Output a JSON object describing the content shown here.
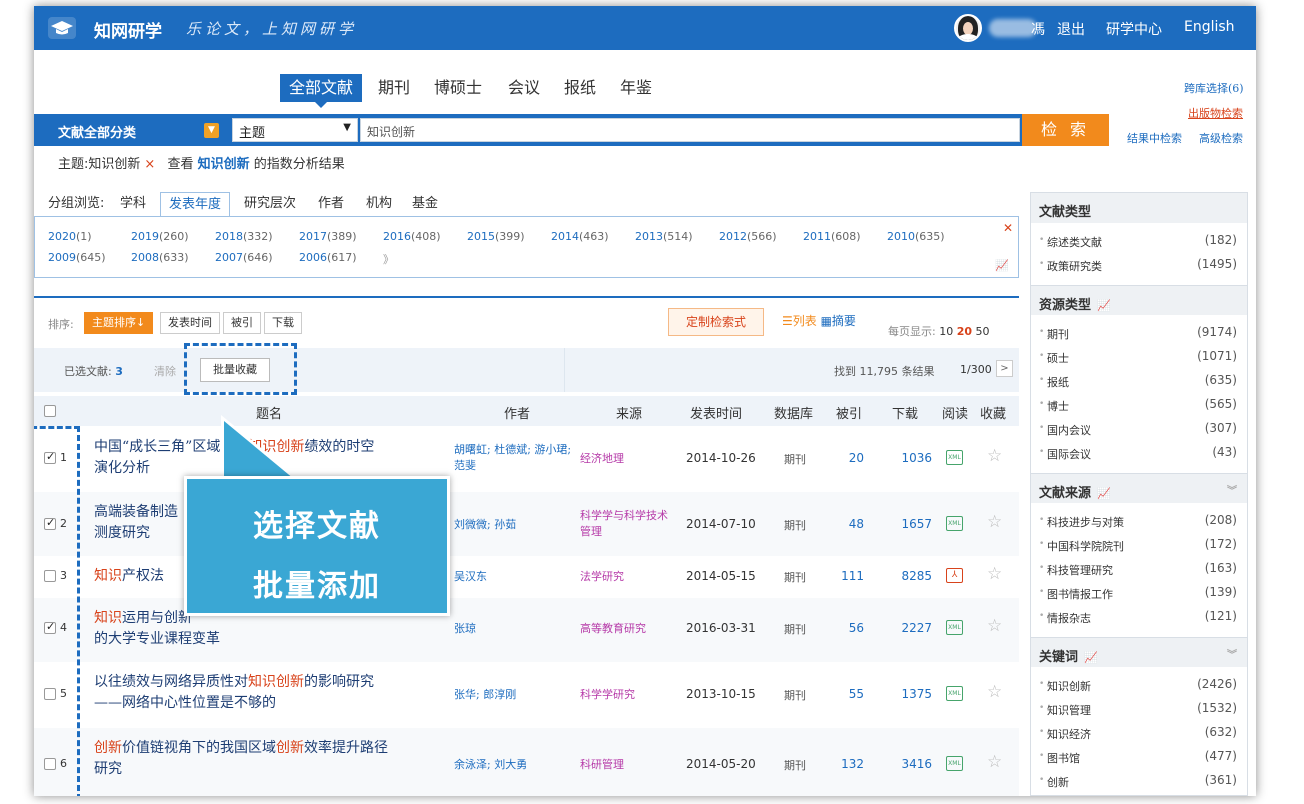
{
  "header": {
    "logo_text": "知网研学",
    "slogan": "乐论文，上知网研学",
    "user_suffix": "馮",
    "links": [
      "退出",
      "研学中心",
      "English"
    ]
  },
  "db_tabs": [
    "全部文献",
    "期刊",
    "博硕士",
    "会议",
    "报纸",
    "年鉴"
  ],
  "search": {
    "category": "文献全部分类",
    "field": "主题",
    "query": "知识创新",
    "button": "检 索"
  },
  "side_links": [
    "跨库选择(6)",
    "出版物检索",
    "结果中检索",
    "高级检索"
  ],
  "crumb": {
    "filter": "主题:知识创新",
    "close": "×",
    "prefix": "查看",
    "keyword": "知识创新",
    "suffix": "的指数分析结果"
  },
  "group_browse": {
    "label": "分组浏览:",
    "items": [
      "学科",
      "发表年度",
      "研究层次",
      "作者",
      "机构",
      "基金"
    ],
    "active": "发表年度"
  },
  "years_row1": [
    {
      "year": "2020",
      "count": "(1)"
    },
    {
      "year": "2019",
      "count": "(260)"
    },
    {
      "year": "2018",
      "count": "(332)"
    },
    {
      "year": "2017",
      "count": "(389)"
    },
    {
      "year": "2016",
      "count": "(408)"
    },
    {
      "year": "2015",
      "count": "(399)"
    },
    {
      "year": "2014",
      "count": "(463)"
    },
    {
      "year": "2013",
      "count": "(514)"
    },
    {
      "year": "2012",
      "count": "(566)"
    },
    {
      "year": "2011",
      "count": "(608)"
    },
    {
      "year": "2010",
      "count": "(635)"
    }
  ],
  "years_row2": [
    {
      "year": "2009",
      "count": "(645)"
    },
    {
      "year": "2008",
      "count": "(633)"
    },
    {
      "year": "2007",
      "count": "(646)"
    },
    {
      "year": "2006",
      "count": "(617)"
    },
    {
      "year": "》",
      "count": ""
    }
  ],
  "toolbar": {
    "sort_label": "排序:",
    "sort_buttons": [
      "主题排序↓",
      "发表时间",
      "被引",
      "下载"
    ],
    "custom": "定制检索式",
    "view_list": "☰列表",
    "view_abstract": "▦摘要",
    "per_page_label": "每页显示:",
    "per_page": [
      "10",
      "20",
      "50"
    ]
  },
  "selection": {
    "label": "已选文献:",
    "count": "3",
    "clear": "清除",
    "batch": "批量收藏",
    "found": "找到 11,795 条结果",
    "pager": "1/300"
  },
  "columns": [
    "题名",
    "作者",
    "来源",
    "发表时间",
    "数据库",
    "被引",
    "下载",
    "阅读",
    "收藏"
  ],
  "rows": [
    {
      "num": "1",
      "checked": true,
      "t1a": "中国“成长三角”区域高校",
      "t1h": "知识创新",
      "t1b": "绩效的时空",
      "t2": "演化分析",
      "author": "胡曙虹; 杜德斌; 游小珺; 范斐",
      "source": "经济地理",
      "date": "2014-10-26",
      "db": "期刊",
      "cite": "20",
      "dl": "1036",
      "fmt": "XML"
    },
    {
      "num": "2",
      "checked": true,
      "t1a": "高端装备制造",
      "t1h": "",
      "t1b": "",
      "t2": "测度研究",
      "author": "刘微微; 孙茹",
      "source": "科学学与科学技术管理",
      "date": "2014-07-10",
      "db": "期刊",
      "cite": "48",
      "dl": "1657",
      "fmt": "XML"
    },
    {
      "num": "3",
      "checked": false,
      "t1a": "",
      "t1h": "知识",
      "t1b": "产权法",
      "t2": "",
      "author": "吴汉东",
      "source": "法学研究",
      "date": "2014-05-15",
      "db": "期刊",
      "cite": "111",
      "dl": "8285",
      "fmt": "PDF"
    },
    {
      "num": "4",
      "checked": true,
      "t1a": "",
      "t1h": "知识",
      "t1b": "运用与创新",
      "t2": "的大学专业课程变革",
      "author": "张琼",
      "source": "高等教育研究",
      "date": "2016-03-31",
      "db": "期刊",
      "cite": "56",
      "dl": "2227",
      "fmt": "XML"
    },
    {
      "num": "5",
      "checked": false,
      "t1a": "以往绩效与网络异质性对",
      "t1h": "知识创新",
      "t1b": "的影响研究",
      "t2": "——网络中心性位置是不够的",
      "author": "张华; 郎淳刚",
      "source": "科学学研究",
      "date": "2013-10-15",
      "db": "期刊",
      "cite": "55",
      "dl": "1375",
      "fmt": "XML"
    },
    {
      "num": "6",
      "checked": false,
      "t1a": "",
      "t1h": "创新",
      "t1b": "价值链视角下的我国区域",
      "t1h2": "创新",
      "t1c": "效率提升路径",
      "t2": "研究",
      "author": "余泳泽; 刘大勇",
      "source": "科研管理",
      "date": "2014-05-20",
      "db": "期刊",
      "cite": "132",
      "dl": "3416",
      "fmt": "XML"
    }
  ],
  "callout": {
    "line1": "选择文献",
    "line2": "批量添加"
  },
  "sidebar": {
    "sections": [
      {
        "title": "文献类型",
        "chart": false,
        "items": [
          {
            "label": "综述类文献",
            "count": "(182)"
          },
          {
            "label": "政策研究类",
            "count": "(1495)"
          }
        ]
      },
      {
        "title": "资源类型",
        "chart": true,
        "items": [
          {
            "label": "期刊",
            "count": "(9174)"
          },
          {
            "label": "硕士",
            "count": "(1071)"
          },
          {
            "label": "报纸",
            "count": "(635)"
          },
          {
            "label": "博士",
            "count": "(565)"
          },
          {
            "label": "国内会议",
            "count": "(307)"
          },
          {
            "label": "国际会议",
            "count": "(43)"
          }
        ]
      },
      {
        "title": "文献来源",
        "chart": true,
        "items": [
          {
            "label": "科技进步与对策",
            "count": "(208)"
          },
          {
            "label": "中国科学院院刊",
            "count": "(172)"
          },
          {
            "label": "科技管理研究",
            "count": "(163)"
          },
          {
            "label": "图书情报工作",
            "count": "(139)"
          },
          {
            "label": "情报杂志",
            "count": "(121)"
          }
        ]
      },
      {
        "title": "关键词",
        "chart": true,
        "items": [
          {
            "label": "知识创新",
            "count": "(2426)"
          },
          {
            "label": "知识管理",
            "count": "(1532)"
          },
          {
            "label": "知识经济",
            "count": "(632)"
          },
          {
            "label": "图书馆",
            "count": "(477)"
          },
          {
            "label": "创新",
            "count": "(361)"
          }
        ]
      }
    ]
  },
  "colors": {
    "brand": "#1d6cbf",
    "accent": "#f28a1c",
    "highlight": "#d8431b",
    "callout": "#3aa7d4"
  }
}
